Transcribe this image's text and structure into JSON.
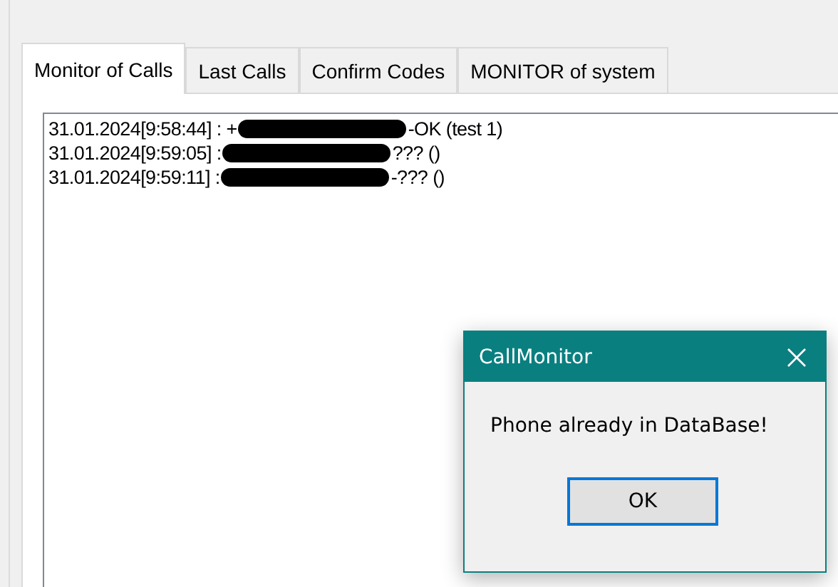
{
  "tabs": [
    {
      "label": "Monitor of Calls",
      "selected": true
    },
    {
      "label": "Last Calls",
      "selected": false
    },
    {
      "label": "Confirm Codes",
      "selected": false
    },
    {
      "label": "MONITOR of system",
      "selected": false
    }
  ],
  "log": [
    {
      "prefix": "31.01.2024[9:58:44] : +",
      "suffix": "-OK (test 1)"
    },
    {
      "prefix": "31.01.2024[9:59:05] :",
      "suffix": "??? ()"
    },
    {
      "prefix": "31.01.2024[9:59:11] :",
      "suffix": "-??? ()"
    }
  ],
  "dialog": {
    "title": "CallMonitor",
    "message": "Phone already in DataBase!",
    "button": "OK"
  }
}
